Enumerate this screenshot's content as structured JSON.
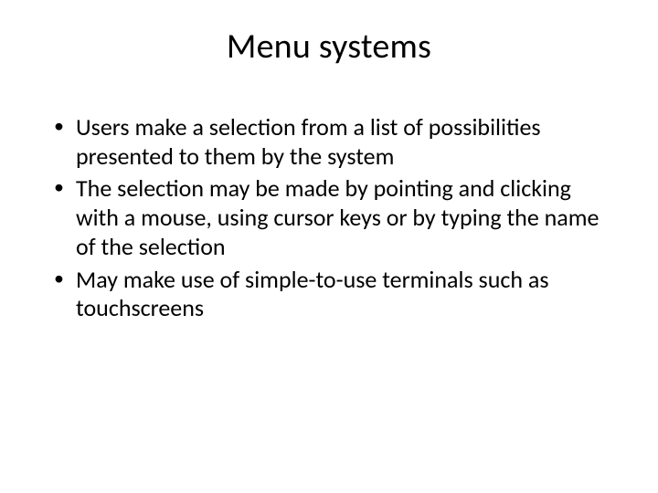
{
  "slide": {
    "title": "Menu systems",
    "bullets": [
      "Users make a selection from a list of possibilities presented to them by the system",
      "The selection may be made by pointing and clicking with a mouse, using cursor keys or by typing the name of the selection",
      "May make use of simple-to-use terminals such as touchscreens"
    ]
  }
}
